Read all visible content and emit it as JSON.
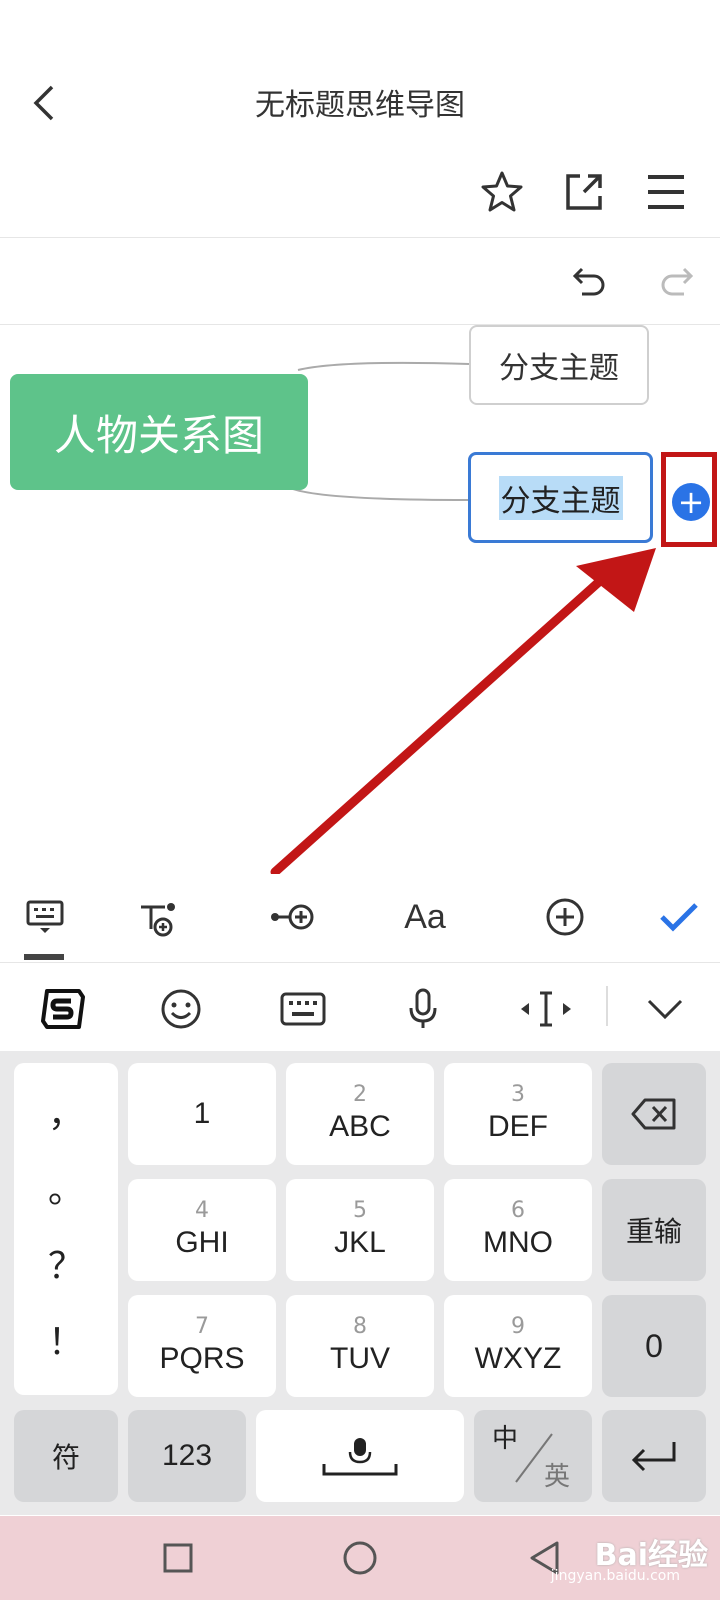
{
  "header": {
    "title": "无标题思维导图",
    "back_icon": "chevron-left-icon",
    "actions": [
      "star-icon",
      "share-icon",
      "menu-icon"
    ]
  },
  "history": {
    "undo_icon": "undo-icon",
    "redo_icon": "redo-icon"
  },
  "mindmap": {
    "root": "人物关系图",
    "branches": [
      "分支主题",
      "分支主题"
    ],
    "selected_branch_index": 1,
    "add_child_symbol": "+"
  },
  "edit_toolbar": {
    "items": [
      "keyboard-icon",
      "add-subtopic-icon",
      "add-sibling-icon",
      "text-style-icon",
      "add-circle-icon",
      "confirm-check-icon"
    ],
    "text_style_label": "Aa"
  },
  "keyboard": {
    "toolbar": [
      "sogou-logo-icon",
      "emoji-icon",
      "keyboard-switch-icon",
      "microphone-icon",
      "cursor-move-icon",
      "collapse-keyboard-icon"
    ],
    "punctuation": [
      "，",
      "。",
      "？",
      "！"
    ],
    "keys": [
      {
        "num": "",
        "letters": "1"
      },
      {
        "num": "2",
        "letters": "ABC"
      },
      {
        "num": "3",
        "letters": "DEF"
      },
      {
        "num": "4",
        "letters": "GHI"
      },
      {
        "num": "5",
        "letters": "JKL"
      },
      {
        "num": "6",
        "letters": "MNO"
      },
      {
        "num": "7",
        "letters": "PQRS"
      },
      {
        "num": "8",
        "letters": "TUV"
      },
      {
        "num": "9",
        "letters": "WXYZ"
      }
    ],
    "retype_label": "重输",
    "zero_label": "0",
    "symbols_label": "符",
    "numbers_label": "123",
    "chinese_label": "中",
    "english_label": "英"
  },
  "navbar": [
    "square-icon",
    "circle-icon",
    "triangle-back-icon"
  ],
  "watermark": {
    "brand": "Bai经验",
    "url": "jingyan.baidu.com"
  },
  "colors": {
    "root_node": "#5ec38a",
    "accent": "#2a73e6",
    "highlight": "#c21616",
    "arrow": "#c21616"
  }
}
